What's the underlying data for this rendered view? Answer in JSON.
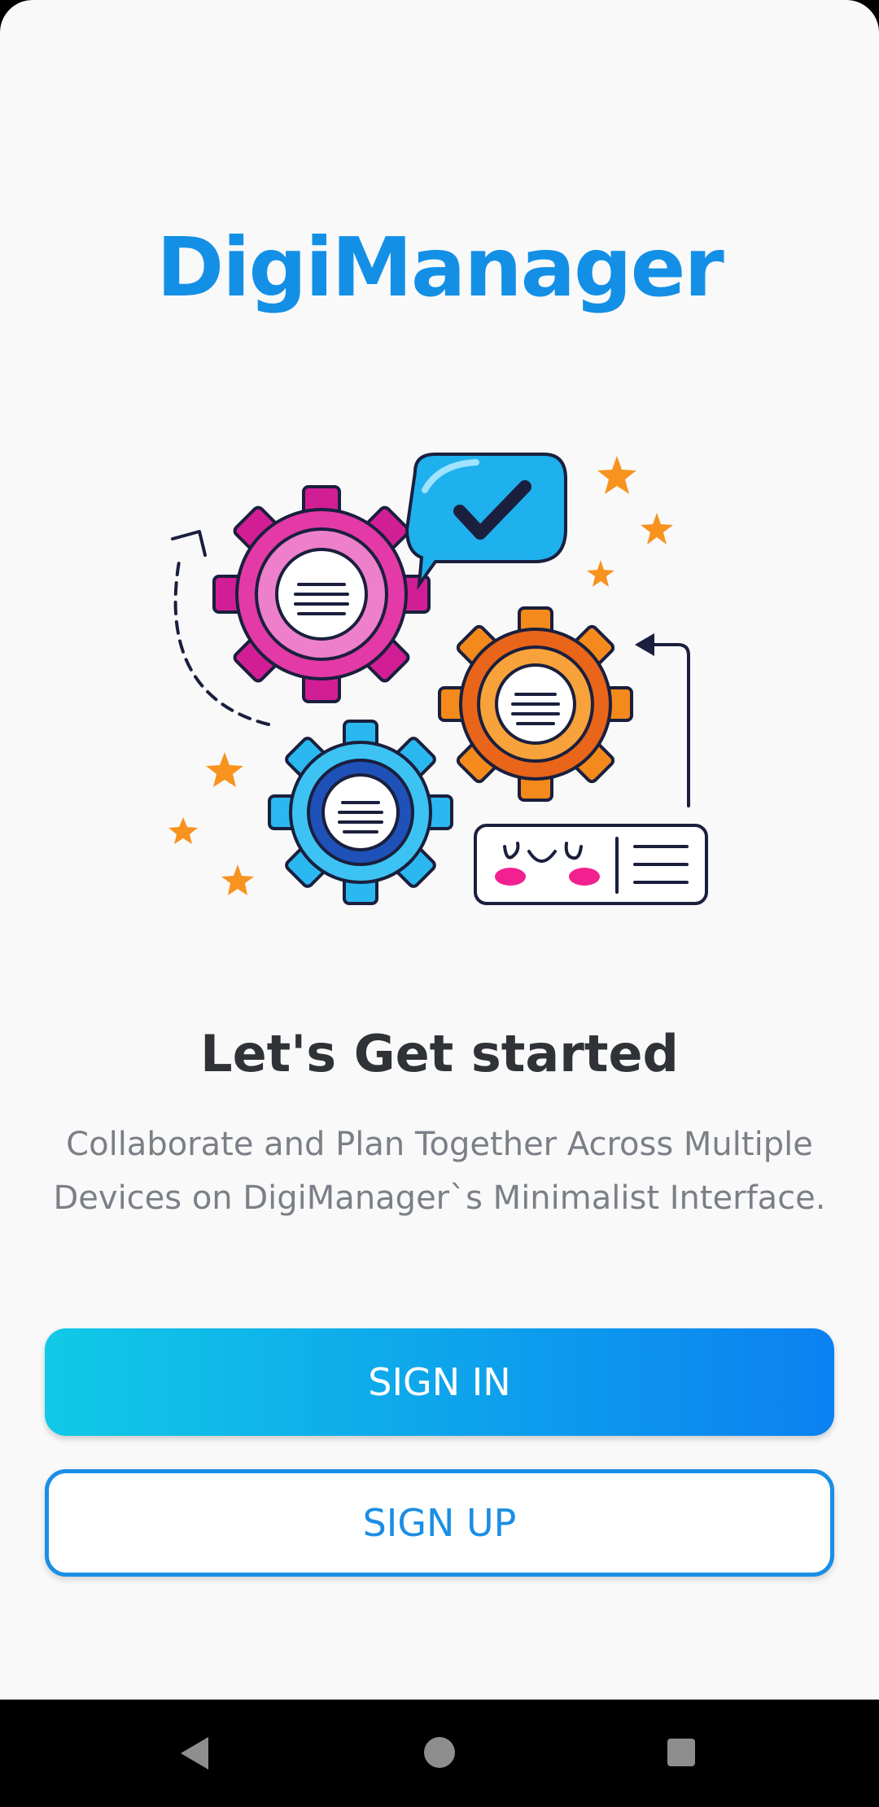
{
  "app": {
    "title": "DigiManager"
  },
  "illustration": {
    "name": "gears-collaboration-illustration"
  },
  "onboarding": {
    "heading": "Let's Get started",
    "subtitle_line1": "Collaborate and Plan Together Across Multiple",
    "subtitle_line2": "Devices on DigiManager`s Minimalist Interface."
  },
  "buttons": {
    "sign_in": "SIGN IN",
    "sign_up": "SIGN UP"
  },
  "colors": {
    "brand": "#1390e6",
    "gradient_start": "#11c9e6",
    "gradient_end": "#0b81f1",
    "background": "#f9f9fa"
  },
  "navbar": {
    "icons": [
      "back-icon",
      "home-icon",
      "recents-icon"
    ]
  }
}
